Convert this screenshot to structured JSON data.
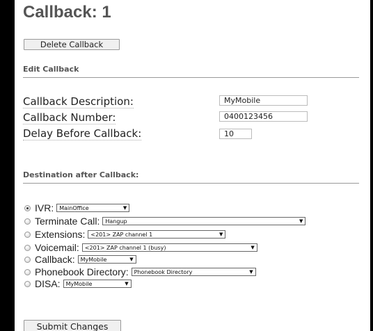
{
  "page": {
    "title": "Callback: 1"
  },
  "actions": {
    "delete_label": "Delete Callback",
    "submit_label": "Submit Changes"
  },
  "edit_section": {
    "title": "Edit Callback"
  },
  "fields": {
    "description": {
      "label": "Callback Description:",
      "value": "MyMobile"
    },
    "number": {
      "label": "Callback Number:",
      "value": "0400123456"
    },
    "delay": {
      "label": "Delay Before Callback:",
      "value": "10"
    }
  },
  "destination": {
    "title": "Destination after Callback:",
    "options": [
      {
        "label": "IVR:",
        "selected_value": "MainOffice",
        "checked": true
      },
      {
        "label": "Terminate Call:",
        "selected_value": "Hangup",
        "checked": false
      },
      {
        "label": "Extensions:",
        "selected_value": "<201> ZAP channel 1",
        "checked": false
      },
      {
        "label": "Voicemail:",
        "selected_value": "<201> ZAP channel 1 (busy)",
        "checked": false
      },
      {
        "label": "Callback:",
        "selected_value": "MyMobile",
        "checked": false
      },
      {
        "label": "Phonebook Directory:",
        "selected_value": "Phonebook Directory",
        "checked": false
      },
      {
        "label": "DISA:",
        "selected_value": "MyMobile",
        "checked": false
      }
    ]
  },
  "icons": {
    "dropdown": "triangle-down-icon",
    "radio": "radio-button-icon"
  },
  "colors": {
    "frame": "#000000",
    "background": "#ffffff",
    "heading": "#555555",
    "divider": "#999999"
  }
}
